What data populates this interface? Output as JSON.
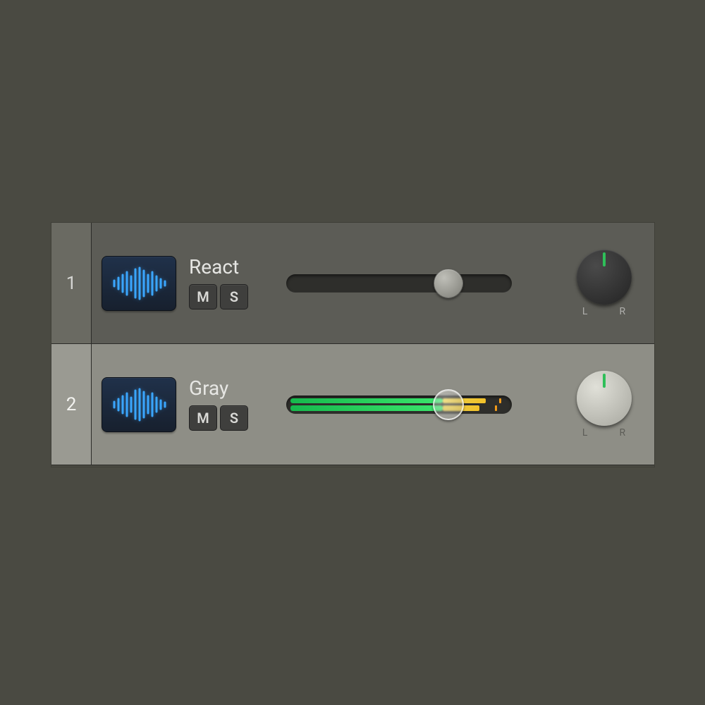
{
  "tracks": [
    {
      "index": "1",
      "name": "React",
      "mute_label": "M",
      "solo_label": "S",
      "l_label": "L",
      "r_label": "R",
      "selected": false,
      "fader_percent": 72,
      "meter": null
    },
    {
      "index": "2",
      "name": "Gray",
      "mute_label": "M",
      "solo_label": "S",
      "l_label": "L",
      "r_label": "R",
      "selected": true,
      "fader_percent": 72,
      "meter": {
        "ch1": {
          "green": 70,
          "yellow_start": 70,
          "yellow_end": 90,
          "tick": 96
        },
        "ch2": {
          "green": 70,
          "yellow_start": 70,
          "yellow_end": 87,
          "tick": 94
        }
      }
    }
  ]
}
